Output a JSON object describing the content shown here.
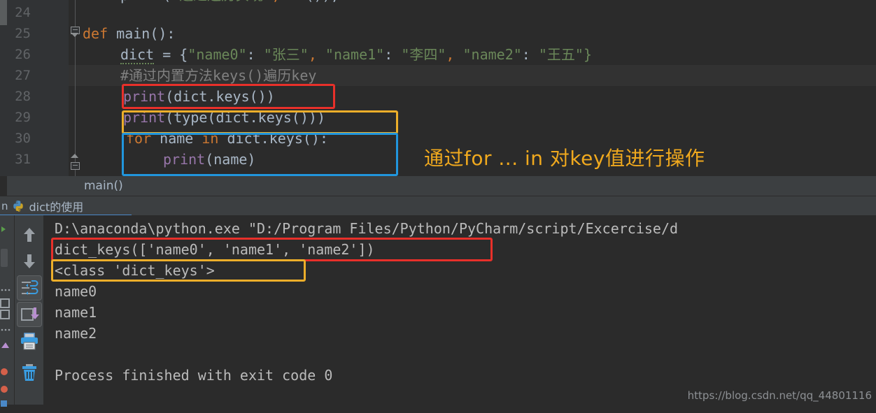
{
  "editor": {
    "line_numbers": [
      "24",
      "25",
      "26",
      "27",
      "28",
      "29",
      "30",
      "31"
    ],
    "lines": [
      {
        "indent": 0,
        "text": ""
      },
      {
        "indent": 0,
        "text": "def main():"
      },
      {
        "indent": 1,
        "text": "dict = {\"name0\": \"张三\", \"name1\": \"李四\", \"name2\": \"王五\"}"
      },
      {
        "indent": 1,
        "text": "#通过内置方法keys()遍历key"
      },
      {
        "indent": 1,
        "text": "print(dict.keys())"
      },
      {
        "indent": 1,
        "text": "print(type(dict.keys()))"
      },
      {
        "indent": 1,
        "text": "for name in dict.keys():"
      },
      {
        "indent": 2,
        "text": "print(name)"
      }
    ],
    "tokens": {
      "def": "def",
      "main_sig": " main():",
      "dict_name": "dict",
      "equals": " = {",
      "key0": "\"name0\"",
      "colon": ": ",
      "val0": "\"张三\"",
      "comma": ", ",
      "key1": "\"name1\"",
      "val1": "\"李四\"",
      "key2": "\"name2\"",
      "val2": "\"王五\"",
      "brace_close": "}",
      "comment": "#通过内置方法keys()遍历key",
      "print": "print",
      "paren_dict_keys": "(dict.keys())",
      "paren_type": "(type(dict.keys()))",
      "for": "for",
      "name_var": " name ",
      "in": "in",
      "dict_keys_colon": " dict.keys():",
      "paren_name": "(name)"
    },
    "annotation": "通过for ... in 对key值进行操作",
    "annotation_color": "#f0a91e",
    "highlight_colors": {
      "red": "#e8302a",
      "amber": "#ecae2a",
      "blue": "#2196dd"
    },
    "current_line": "27"
  },
  "breadcrumb": {
    "text": "main()"
  },
  "run_tab": {
    "truncated_prefix": "n",
    "label": "dict的使用",
    "icon": "python-icon"
  },
  "run_toolbar": {
    "buttons": [
      {
        "name": "up-arrow-icon",
        "label": "Up"
      },
      {
        "name": "down-arrow-icon",
        "label": "Down"
      },
      {
        "name": "soft-wrap-icon",
        "label": "Soft-Wrap"
      },
      {
        "name": "scroll-to-end-icon",
        "label": "Scroll to End"
      },
      {
        "name": "print-icon",
        "label": "Print"
      },
      {
        "name": "trash-icon",
        "label": "Clear All"
      }
    ]
  },
  "console": {
    "lines": [
      "D:\\anaconda\\python.exe \"D:/Program Files/Python/PyCharm/script/Excercise/d",
      "dict_keys(['name0', 'name1', 'name2'])",
      "<class 'dict_keys'>",
      "name0",
      "name1",
      "name2",
      "",
      "Process finished with exit code 0"
    ],
    "highlight_colors": {
      "red": "#e8302a",
      "amber": "#ecae2a"
    }
  },
  "watermark": {
    "text": "https://blog.csdn.net/qq_44801116"
  }
}
